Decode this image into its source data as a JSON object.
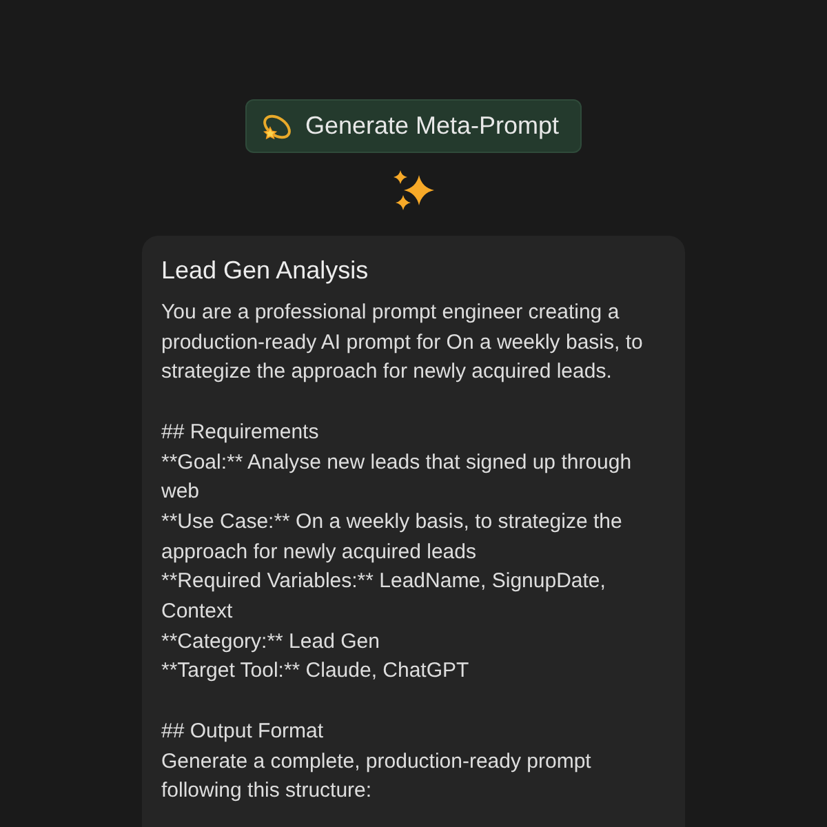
{
  "action_button": {
    "label": "Generate Meta-Prompt"
  },
  "prompt_card": {
    "title": "Lead Gen Analysis",
    "paragraphs": [
      [
        "You are a professional prompt engineer creating a production-ready AI prompt for On a weekly basis, to strategize the approach for newly acquired leads."
      ],
      [
        "## Requirements",
        "**Goal:** Analyse new leads that signed up through web",
        "**Use Case:** On a weekly basis, to strategize the approach for newly acquired leads",
        "**Required Variables:** LeadName, SignupDate, Context",
        "**Category:** Lead Gen",
        "**Target Tool:** Claude, ChatGPT"
      ],
      [
        "## Output Format",
        "Generate a complete, production-ready prompt following this structure:"
      ]
    ]
  }
}
